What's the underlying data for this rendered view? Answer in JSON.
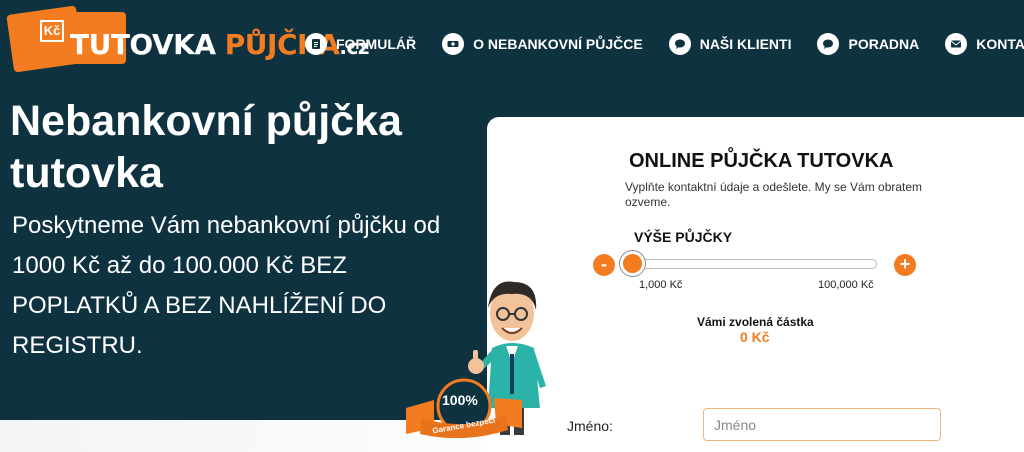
{
  "logo": {
    "kc": "Kč",
    "part1": "TUTOVKA ",
    "part2": "PŮJČKA",
    "part3": ".cz",
    "icon": "logo-card"
  },
  "nav": {
    "items": [
      {
        "label": "FORMULÁŘ",
        "icon": "document-icon"
      },
      {
        "label": "O NEBANKOVNÍ PŮJČCE",
        "icon": "money-icon"
      },
      {
        "label": "NAŠI KLIENTI",
        "icon": "chat-icon"
      },
      {
        "label": "PORADNA",
        "icon": "chat-icon"
      },
      {
        "label": "KONTAKT",
        "icon": "envelope-icon"
      }
    ]
  },
  "hero": {
    "title": "Nebankovní půjčka tutovka",
    "subtitle": "Poskytneme Vám nebankovní půjčku od 1000 Kč až do 100.000 Kč BEZ POPLATKŮ A BEZ NAHLÍŽENÍ DO REGISTRU."
  },
  "form": {
    "title": "ONLINE PŮJČKA TUTOVKA",
    "description": "Vyplňte kontaktní údaje a odešlete. My se Vám obratem ozveme.",
    "amount_label": "VÝŠE PŮJČKY",
    "minus": "-",
    "plus": "+",
    "min_label": "1,000 Kč",
    "max_label": "100,000 Kč",
    "slider_value_fraction": 0,
    "chosen_label": "Vámi zvolená částka",
    "chosen_value": "0 Kč",
    "name_label": "Jméno:",
    "name_placeholder": "Jméno",
    "name_value": ""
  },
  "badge": {
    "percent": "100%",
    "text": "Garance bezpečí"
  },
  "colors": {
    "hero_bg": "#0f3240",
    "accent": "#f47c20",
    "white": "#ffffff"
  }
}
